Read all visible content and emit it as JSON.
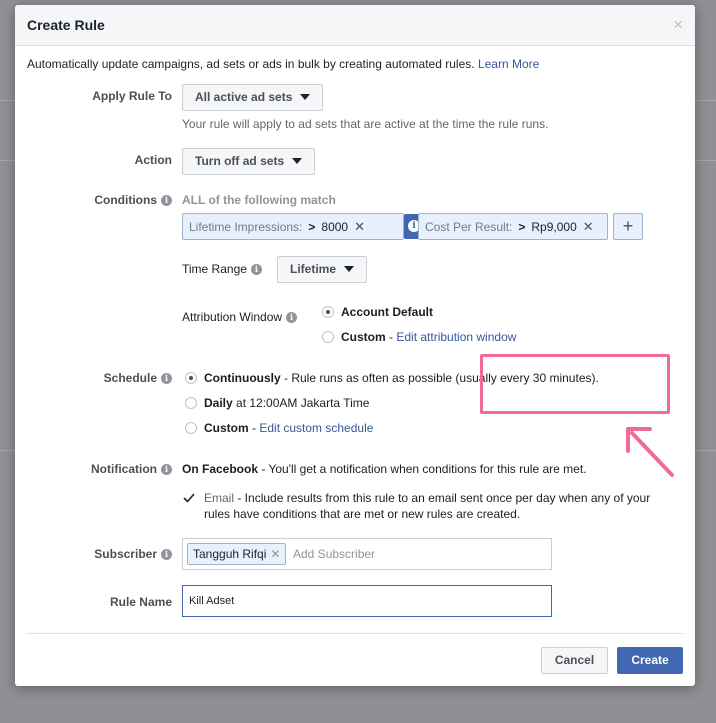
{
  "modal": {
    "title": "Create Rule",
    "close": "×",
    "intro": "Automatically update campaigns, ad sets or ads in bulk by creating automated rules.",
    "learn_more": "Learn More"
  },
  "apply_rule": {
    "label": "Apply Rule To",
    "value": "All active ad sets",
    "help": "Your rule will apply to ad sets that are active at the time the rule runs."
  },
  "action": {
    "label": "Action",
    "value": "Turn off ad sets"
  },
  "conditions": {
    "label": "Conditions",
    "header": "ALL of the following match",
    "items": [
      {
        "metric": "Lifetime Impressions:",
        "operator": ">",
        "value": "8000"
      },
      {
        "metric": "Cost Per Result:",
        "operator": ">",
        "value": "Rp9,000"
      }
    ],
    "time_range_label": "Time Range",
    "time_range_value": "Lifetime",
    "attribution_label": "Attribution Window",
    "attribution_options": [
      {
        "label": "Account Default",
        "extra": "",
        "selected": true
      },
      {
        "label": "Custom",
        "extra": "Edit attribution window",
        "selected": false
      }
    ]
  },
  "schedule": {
    "label": "Schedule",
    "options": [
      {
        "label": "Continuously",
        "desc": " - Rule runs as often as possible (usually every 30 minutes).",
        "selected": true
      },
      {
        "label": "Daily",
        "desc": " at 12:00AM Jakarta Time",
        "selected": false
      },
      {
        "label": "Custom",
        "desc": " - ",
        "link": "Edit custom schedule",
        "selected": false
      }
    ]
  },
  "notification": {
    "label": "Notification",
    "facebook_bold": "On Facebook",
    "facebook_desc": " - You'll get a notification when conditions for this rule are met.",
    "email_label": "Email",
    "email_desc_1": " - Include results from this rule to an email sent once per day when any of your",
    "email_desc_2": "rules have conditions that are met or new rules are created.",
    "email_checked": true
  },
  "subscriber": {
    "label": "Subscriber",
    "tag": "Tangguh Rifqi",
    "placeholder": "Add Subscriber"
  },
  "rule_name": {
    "label": "Rule Name",
    "value": "Kill Adset"
  },
  "buttons": {
    "cancel": "Cancel",
    "create": "Create"
  },
  "colors": {
    "accent": "#4267b2",
    "link": "#365899",
    "highlight": "#f06a9c"
  }
}
